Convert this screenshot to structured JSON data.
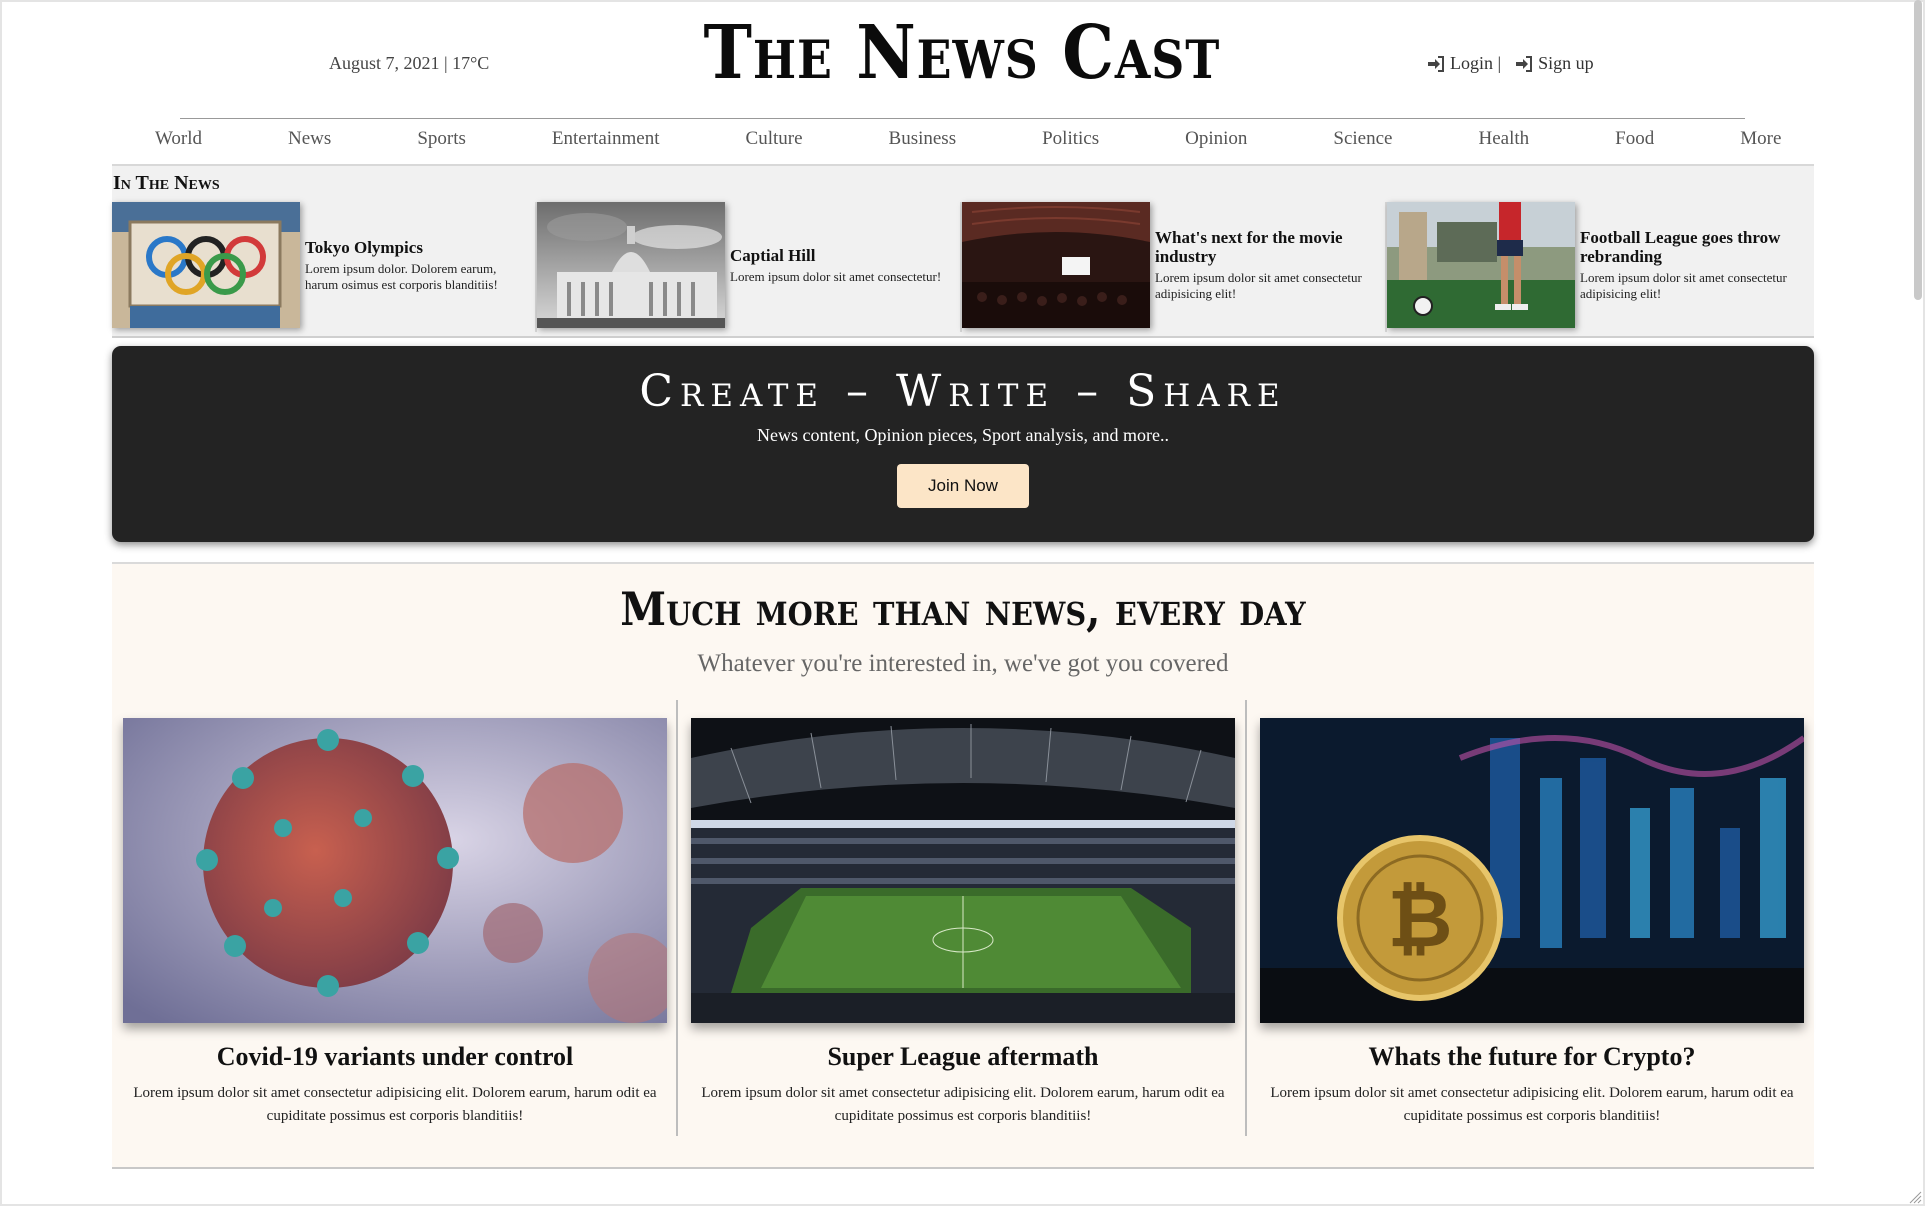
{
  "header": {
    "date_weather": "August 7, 2021 | 17°C",
    "logo": "The News Cast",
    "login": "Login |",
    "signup": "Sign up"
  },
  "nav": [
    "World",
    "News",
    "Sports",
    "Entertainment",
    "Culture",
    "Business",
    "Politics",
    "Opinion",
    "Science",
    "Health",
    "Food",
    "More"
  ],
  "in_the_news": {
    "title": "In The News",
    "cards": [
      {
        "title": "Tokyo Olympics",
        "text": "Lorem ipsum dolor. Dolorem earum, harum osimus est corporis blanditiis!"
      },
      {
        "title": "Captial Hill",
        "text": "Lorem ipsum dolor sit amet consectetur!"
      },
      {
        "title": "What's next for the movie industry",
        "text": "Lorem ipsum dolor sit amet consectetur adipisicing elit!"
      },
      {
        "title": "Football League goes throw rebranding",
        "text": "Lorem ipsum dolor sit amet consectetur adipisicing elit!"
      }
    ]
  },
  "banner": {
    "title": "Create – Write – Share",
    "subtitle": "News content, Opinion pieces, Sport analysis, and more..",
    "button": "Join Now"
  },
  "features": {
    "title": "Much more than news, every day",
    "tagline": "Whatever you're interested in, we've got you covered",
    "items": [
      {
        "title": "Covid-19 variants under control",
        "text": "Lorem ipsum dolor sit amet consectetur adipisicing elit. Dolorem earum, harum odit ea cupiditate possimus est corporis blanditiis!"
      },
      {
        "title": "Super League aftermath",
        "text": "Lorem ipsum dolor sit amet consectetur adipisicing elit. Dolorem earum, harum odit ea cupiditate possimus est corporis blanditiis!"
      },
      {
        "title": "Whats the future for Crypto?",
        "text": "Lorem ipsum dolor sit amet consectetur adipisicing elit. Dolorem earum, harum odit ea cupiditate possimus est corporis blanditiis!"
      }
    ]
  },
  "colors": {
    "banner_bg": "#232323",
    "join_button": "#fce5c7",
    "feature_bg": "#fdf8f2",
    "strip_bg": "#f1f1f1"
  }
}
